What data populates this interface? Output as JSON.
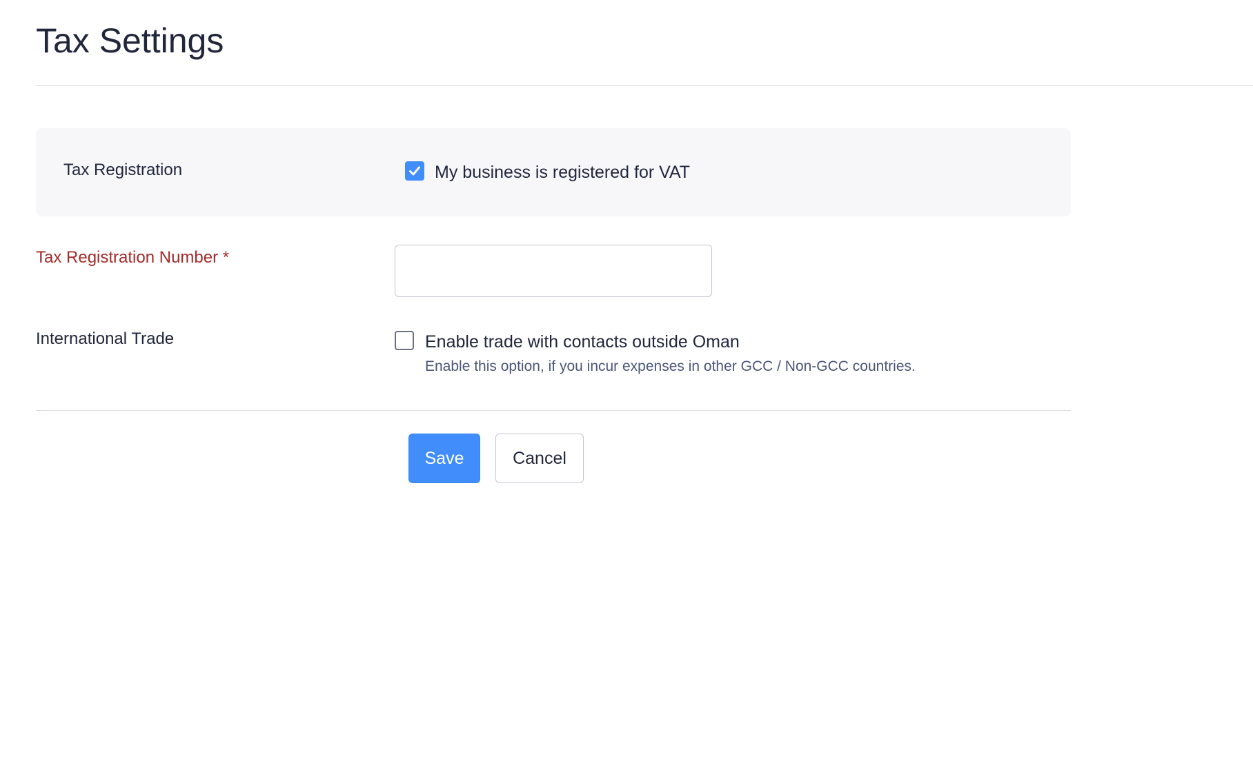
{
  "page": {
    "title": "Tax Settings"
  },
  "tax_registration": {
    "label": "Tax Registration",
    "checkbox_label": "My business is registered for VAT",
    "checked": true
  },
  "tax_registration_number": {
    "label": "Tax Registration Number *",
    "value": "",
    "placeholder": ""
  },
  "international_trade": {
    "label": "International Trade",
    "checkbox_label": "Enable trade with contacts outside Oman",
    "help_text": "Enable this option, if you incur expenses in other GCC / Non-GCC countries.",
    "checked": false
  },
  "actions": {
    "save_label": "Save",
    "cancel_label": "Cancel"
  },
  "colors": {
    "accent": "#408dfb",
    "required_label": "#a52a2a",
    "text": "#21263c",
    "help_text": "#4b5578",
    "section_background": "#f7f7fa"
  }
}
